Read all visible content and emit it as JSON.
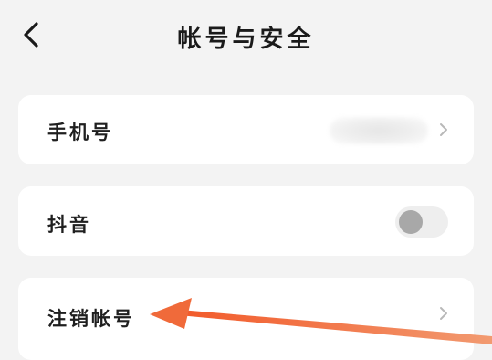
{
  "header": {
    "title": "帐号与安全",
    "back_icon": "chevron-left-icon"
  },
  "settings": {
    "phone": {
      "label": "手机号",
      "value_hidden": true,
      "icon": "chevron-right-icon"
    },
    "douyin": {
      "label": "抖音",
      "toggle_on": false
    },
    "cancel_account": {
      "label": "注销帐号",
      "icon": "chevron-right-icon"
    }
  },
  "annotation": {
    "type": "arrow",
    "points_to": "cancel_account",
    "color": "#f06a3a"
  },
  "colors": {
    "background": "#f3f3f3",
    "card": "#ffffff",
    "text": "#1f1f1f",
    "toggle_off_knob": "#a8a8a8",
    "accent_arrow": "#f06a3a"
  }
}
